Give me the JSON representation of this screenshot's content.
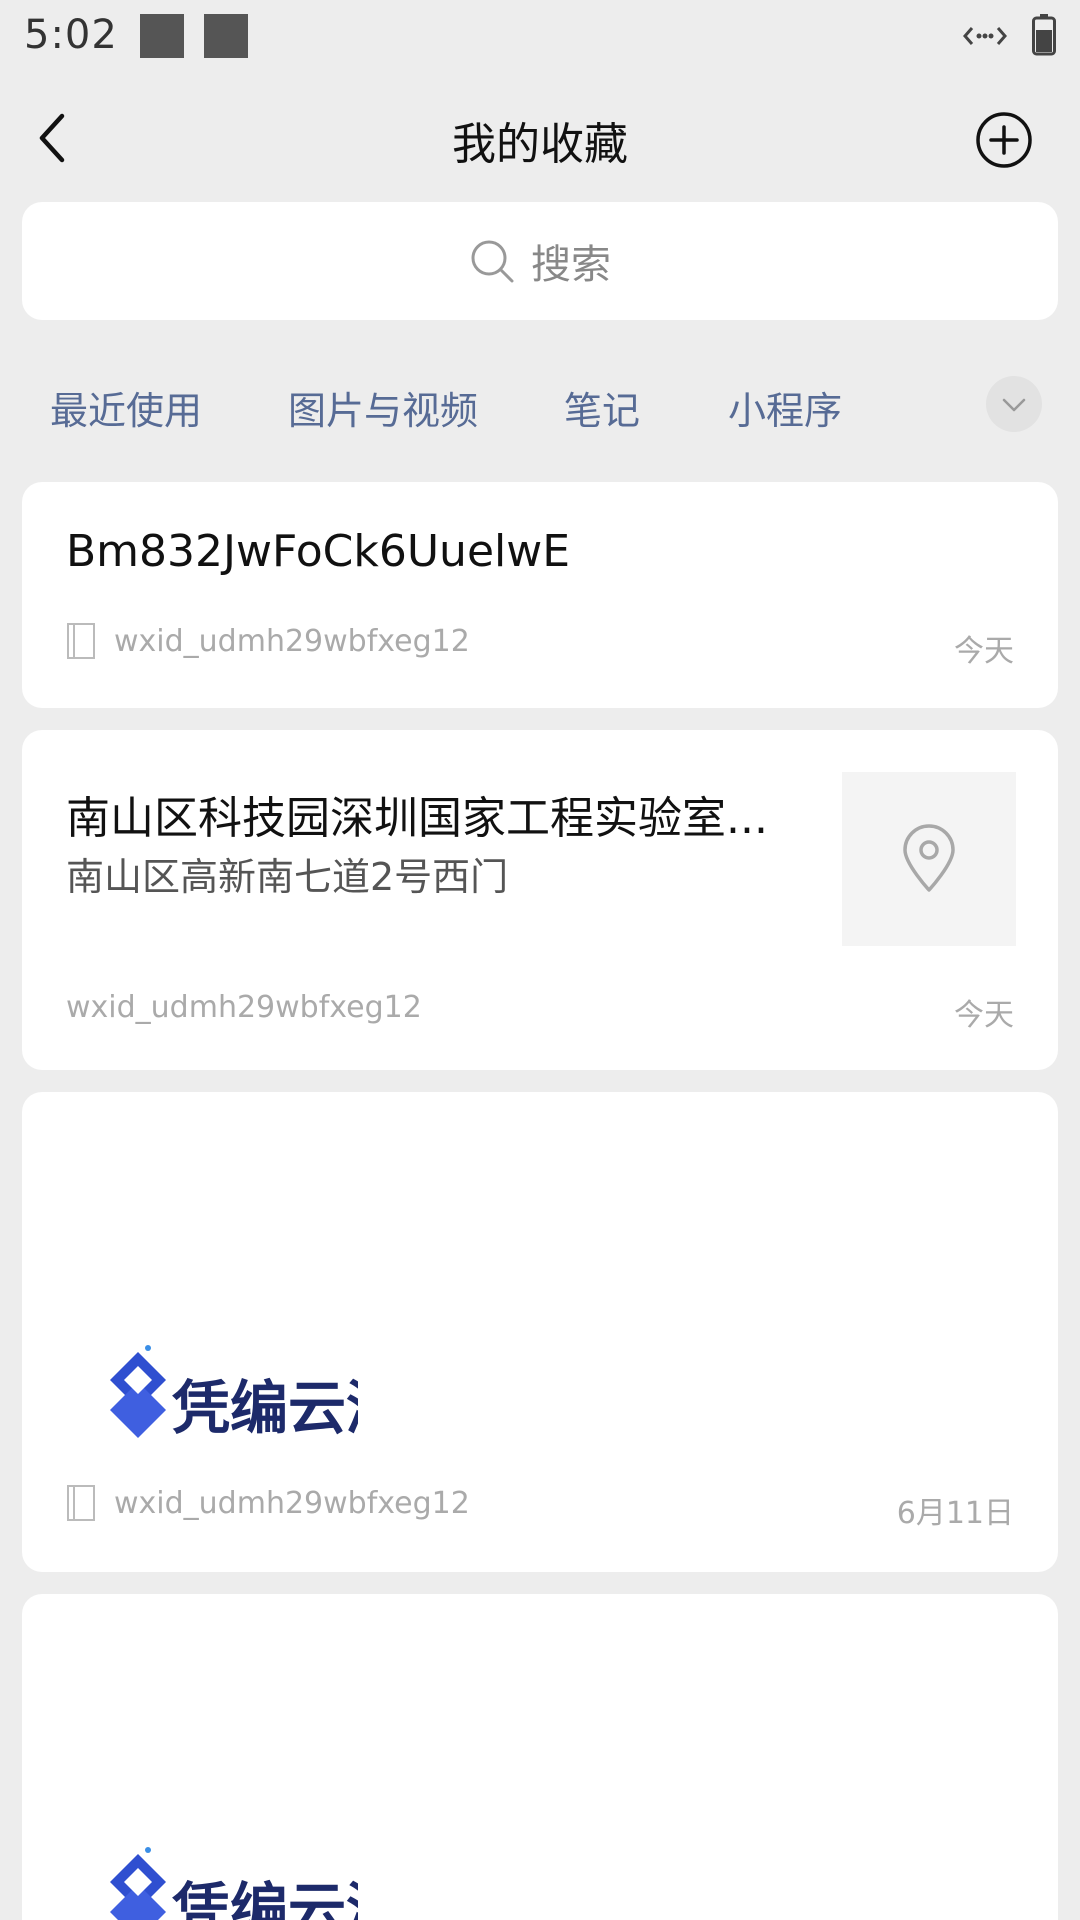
{
  "status_bar": {
    "time": "5:02"
  },
  "header": {
    "title": "我的收藏"
  },
  "search": {
    "placeholder": "搜索"
  },
  "filter_tabs": [
    "最近使用",
    "图片与视频",
    "笔记",
    "小程序"
  ],
  "items": [
    {
      "type": "note",
      "title": "Bm832JwFoCk6UuelwE",
      "source": "wxid_udmh29wbfxeg12",
      "date": "今天"
    },
    {
      "type": "location",
      "title": "南山区科技园深圳国家工程实验室...",
      "subtitle": "南山区高新南七道2号西门",
      "source": "wxid_udmh29wbfxeg12",
      "date": "今天"
    },
    {
      "type": "note-image",
      "logo_text": "凭编云测",
      "source": "wxid_udmh29wbfxeg12",
      "date": "6月11日"
    },
    {
      "type": "note-image",
      "logo_text": "凭编云测"
    }
  ],
  "colors": {
    "background": "#ededed",
    "card": "#ffffff",
    "tab_text": "#576b95",
    "meta_text": "#aaaaaa",
    "logo_blue": "#2f4fd0"
  },
  "icons": [
    "back-arrow-icon",
    "add-circle-icon",
    "search-icon",
    "chevron-down-icon",
    "note-icon",
    "location-pin-icon"
  ]
}
